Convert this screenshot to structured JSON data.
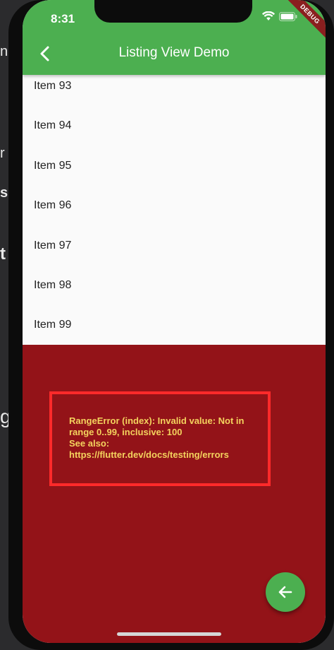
{
  "status_bar": {
    "time": "8:31"
  },
  "debug_banner": "DEBUG",
  "app_bar": {
    "title": "Listing View Demo"
  },
  "list": {
    "items": [
      "Item 93",
      "Item 94",
      "Item 95",
      "Item 96",
      "Item 97",
      "Item 98",
      "Item 99"
    ]
  },
  "error": {
    "line1": "RangeError (index): Invalid value: Not in",
    "line2": "range 0..99, inclusive: 100",
    "line3": "See also:",
    "line4": "https://flutter.dev/docs/testing/errors"
  },
  "background_fragments": [
    "n",
    "r",
    "s",
    "t",
    "g"
  ],
  "colors": {
    "appbar": "#4caf50",
    "error_bg": "#931318",
    "error_text": "#f4d35e",
    "highlight_box": "#ff2a2a"
  },
  "icons": {
    "back": "chevron-left-icon",
    "fab": "arrow-left-icon"
  }
}
